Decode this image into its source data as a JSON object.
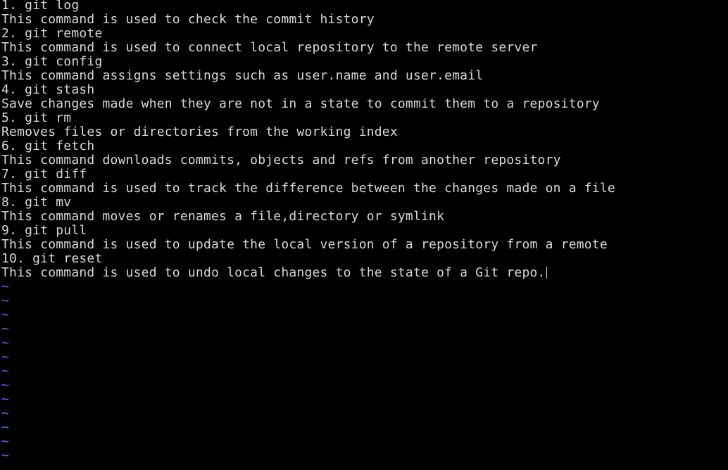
{
  "editor": {
    "lines": [
      "1. git log",
      "This command is used to check the commit history",
      "2. git remote",
      "This command is used to connect local repository to the remote server",
      "3. git config",
      "This command assigns settings such as user.name and user.email",
      "4. git stash",
      "Save changes made when they are not in a state to commit them to a repository",
      "5. git rm",
      "Removes files or directories from the working index",
      "6. git fetch",
      "This command downloads commits, objects and refs from another repository",
      "7. git diff",
      "This command is used to track the difference between the changes made on a file",
      "8. git mv",
      "This command moves or renames a file,directory or symlink",
      "9. git pull",
      "This command is used to update the local version of a repository from a remote",
      "10. git reset",
      "This command is used to undo local changes to the state of a Git repo."
    ],
    "empty_line_marker": "~",
    "empty_line_count": 13,
    "colors": {
      "background": "#000000",
      "text": "#d8d8d8",
      "empty_line_marker": "#5b6cff"
    }
  }
}
